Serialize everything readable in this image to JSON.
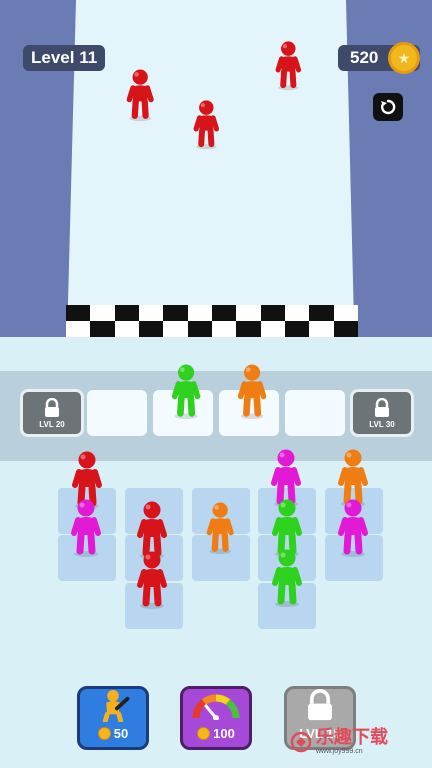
{
  "hud": {
    "level_label": "Level 11",
    "coins": "520",
    "coin_icon": "coin-icon",
    "restart_icon": "restart-icon"
  },
  "merge_row": {
    "left_lock_label": "LVL 20",
    "right_lock_label": "LVL 30"
  },
  "shop": {
    "add_price": "50",
    "speed_price": "100",
    "locked_label": "LVL 15"
  },
  "colors": {
    "red": "#d8141b",
    "magenta": "#e21ad6",
    "orange": "#f07d13",
    "green": "#2ed11d",
    "wall": "#6b7bb3",
    "hud_bg": "#3f4a6b"
  },
  "watermark": {
    "brand": "乐趣下载",
    "url": "www.joy999.cn"
  }
}
